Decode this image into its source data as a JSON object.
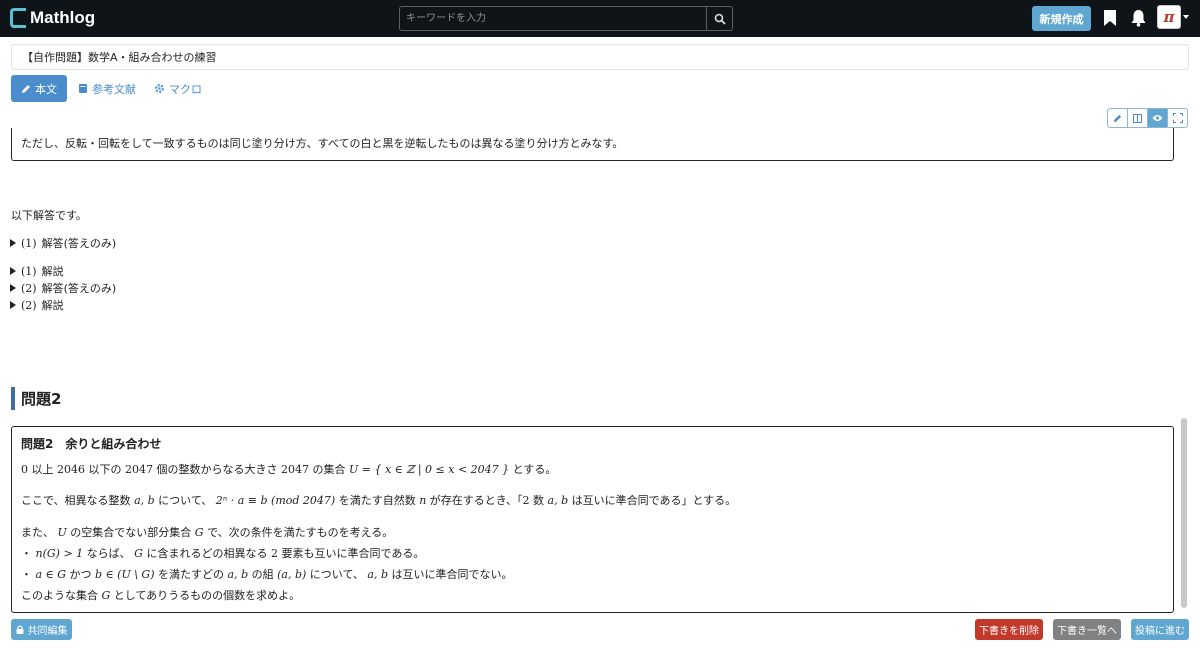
{
  "navbar": {
    "logo_text": "Mathlog",
    "search_placeholder": "キーワードを入力",
    "new_button": "新規作成",
    "avatar_glyph": "π",
    "icons": [
      "bookmark-icon",
      "bell-icon",
      "search-icon"
    ]
  },
  "editor": {
    "title_value": "【自作問題】数学A・組み合わせの練習",
    "tabs": [
      {
        "label": "本文",
        "icon": "pencil-icon",
        "active": true
      },
      {
        "label": "参考文献",
        "icon": "book-icon",
        "active": false
      },
      {
        "label": "マクロ",
        "icon": "gear-icon",
        "active": false
      }
    ],
    "view_modes": [
      "edit",
      "split",
      "preview",
      "fullscreen"
    ],
    "active_view": "preview"
  },
  "content": {
    "prev_box_text": "ただし、反転・回転をして一致するものは同じ塗り分け方、すべての白と黒を逆転したものは異なる塗り分け方とみなす。",
    "answers_intro": "以下解答です。",
    "details": [
      {
        "num": "(1)",
        "label": "解答(答えのみ)"
      },
      {
        "num": "(1)",
        "label": "解説"
      },
      {
        "num": "(2)",
        "label": "解答(答えのみ)"
      },
      {
        "num": "(2)",
        "label": "解説"
      }
    ],
    "heading": "問題2",
    "problem": {
      "title": "問題2　余りと組み合わせ",
      "lines": {
        "l1_a": "0",
        "l1_b": " 以上 ",
        "l1_c": "2046",
        "l1_d": " 以下の ",
        "l1_e": "2047",
        "l1_f": " 個の整数からなる大きさ ",
        "l1_g": "2047",
        "l1_h": " の集合 ",
        "l1_math": "U = { x ∈ ℤ | 0 ≤ x < 2047 }",
        "l1_end": " とする。",
        "l2_a": "ここで、相異なる整数 ",
        "l2_m1": "a, b",
        "l2_b": " について、 ",
        "l2_m2": "2ⁿ · a ≡ b (mod 2047)",
        "l2_c": " を満たす自然数 ",
        "l2_m3": "n",
        "l2_d": " が存在するとき、「",
        "l2_m4": "2",
        "l2_e": " 数 ",
        "l2_m5": "a, b",
        "l2_f": " は互いに準合同である」とする。",
        "l3_a": "また、 ",
        "l3_m1": "U",
        "l3_b": " の空集合でない部分集合 ",
        "l3_m2": "G",
        "l3_c": " で、次の条件を満たすものを考える。",
        "l4_a": "・ ",
        "l4_m1": "n(G) > 1",
        "l4_b": " ならば、 ",
        "l4_m2": "G",
        "l4_c": " に含まれるどの相異なる ",
        "l4_m3": "2",
        "l4_d": " 要素も互いに準合同である。",
        "l5_a": "・ ",
        "l5_m1": "a ∈ G",
        "l5_b": " かつ ",
        "l5_m2": "b ∈ (U \\ G)",
        "l5_c": " を満たすどの ",
        "l5_m3": "a, b",
        "l5_d": " の組 ",
        "l5_m4": "(a, b)",
        "l5_e": " について、 ",
        "l5_m5": "a, b",
        "l5_f": " は互いに準合同でない。",
        "l6_a": "このような集合 ",
        "l6_m1": "G",
        "l6_b": " としてありうるものの個数を求めよ。"
      }
    }
  },
  "footer": {
    "collab_button": "共同編集",
    "delete_draft_button": "下書きを削除",
    "draft_list_button": "下書き一覧へ",
    "proceed_button": "投稿に進む"
  }
}
